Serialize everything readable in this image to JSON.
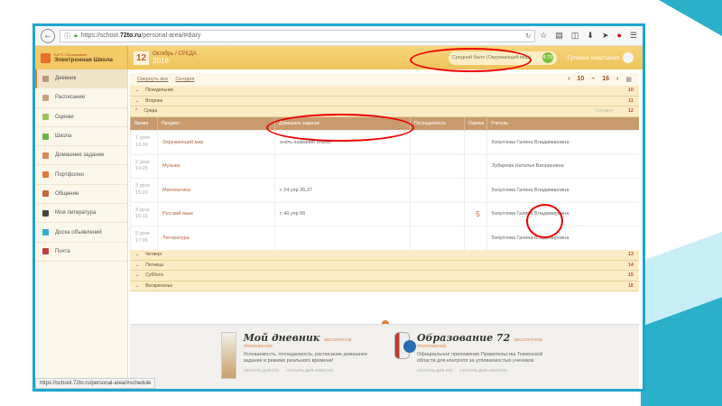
{
  "browser": {
    "url_domain": "https://school.",
    "url_bold": "72to.ru",
    "url_path": "/personal-area/#diary",
    "status_url": "https://school.72to.ru/personal-area/#schedule"
  },
  "header": {
    "brand_small": "БАРС.Образование",
    "brand": "Электронная Школа",
    "day": "12",
    "month_day": "Октябрь / СРЕДА",
    "year": "2016",
    "avg_label": "Средний балл (Окружающий мир)",
    "avg_value": "4.75",
    "user": "Гутвина Анастасия"
  },
  "sidebar": [
    {
      "label": "Дневник",
      "color": "#b89a7a"
    },
    {
      "label": "Расписание",
      "color": "#c8a080"
    },
    {
      "label": "Оценки",
      "color": "#9bc05a"
    },
    {
      "label": "Школа",
      "color": "#6fb04a"
    },
    {
      "label": "Домашнее задание",
      "color": "#d88a5a"
    },
    {
      "label": "Портфолио",
      "color": "#e07b39"
    },
    {
      "label": "Общение",
      "color": "#c06a3a"
    },
    {
      "label": "Моя литература",
      "color": "#444"
    },
    {
      "label": "Доска объявлений",
      "color": "#2bb0c9"
    },
    {
      "label": "Почта",
      "color": "#c04040"
    }
  ],
  "toolbar": {
    "collapse": "Свернуть все",
    "today": "Сегодня",
    "week_from": "10",
    "week_to": "16"
  },
  "days_before": [
    {
      "name": "Понедельник",
      "date": "10"
    },
    {
      "name": "Вторник",
      "date": "11"
    }
  ],
  "current_day": {
    "name": "Среда",
    "today": "Сегодня",
    "date": "12"
  },
  "columns": [
    "Время",
    "Предмет",
    "Домашнее задание",
    "Посещаемость",
    "Оценка",
    "Учитель"
  ],
  "lessons": [
    {
      "n": "1 урок",
      "t": "13:30",
      "subj": "Окружающий мир",
      "hw": "знать название планет",
      "att": "",
      "grade": "",
      "teacher": "Безуглова Галина Владимировна"
    },
    {
      "n": "2 урок",
      "t": "14:25",
      "subj": "Музыка",
      "hw": "",
      "att": "",
      "grade": "",
      "teacher": "Зубарева Наталья Валерьевна"
    },
    {
      "n": "3 урок",
      "t": "15:20",
      "subj": "Математика",
      "hw": "с 24 упр 35,37",
      "att": "",
      "grade": "",
      "teacher": "Безуглова Галина Владимировна"
    },
    {
      "n": "4 урок",
      "t": "16:15",
      "subj": "Русский язык",
      "hw": "с 40 упр 56",
      "att": "",
      "grade": "5",
      "teacher": "Безуглова Галина Владимировна"
    },
    {
      "n": "5 урок",
      "t": "17:05",
      "subj": "Литература",
      "hw": "",
      "att": "",
      "grade": "",
      "teacher": "Безуглова Галина Владимировна"
    }
  ],
  "days_after": [
    {
      "name": "Четверг",
      "date": "13"
    },
    {
      "name": "Пятница",
      "date": "14"
    },
    {
      "name": "Суббота",
      "date": "15"
    },
    {
      "name": "Воскресенье",
      "date": "16"
    }
  ],
  "banner": [
    {
      "title": "Мой дневник",
      "free": "БЕСПЛАТНОЕ ПРИЛОЖЕНИЕ",
      "desc": "Успеваемость, посещаемость, расписание домашнее задание в режиме реального времени!",
      "ios": "СКАЧАТЬ ДЛЯ IOS",
      "android": "СКАЧАТЬ ДЛЯ ANDROID"
    },
    {
      "title": "Образование 72",
      "free": "БЕСПЛАТНОЕ ПРИЛОЖЕНИЕ",
      "desc": "Официальное приложение Правительства Тюменской области для контроля за успеваемостью учеников",
      "ios": "СКАЧАТЬ ДЛЯ IOS",
      "android": "СКАЧАТЬ ДЛЯ ANDROID"
    }
  ]
}
